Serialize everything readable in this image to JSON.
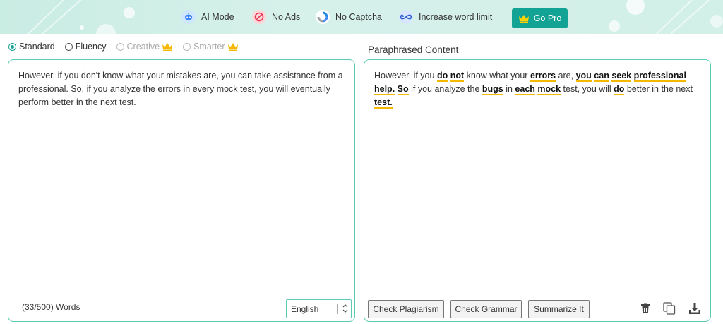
{
  "banner": {
    "features": [
      {
        "label": "AI Mode",
        "icon": "ai-mode-icon"
      },
      {
        "label": "No Ads",
        "icon": "no-ads-icon"
      },
      {
        "label": "No Captcha",
        "icon": "no-captcha-icon"
      },
      {
        "label": "Increase word limit",
        "icon": "infinity-icon"
      }
    ],
    "go_pro_label": "Go Pro"
  },
  "modes": [
    {
      "label": "Standard",
      "checked": true
    },
    {
      "label": "Fluency",
      "checked": false
    },
    {
      "label": "Creative",
      "checked": false,
      "premium": true
    },
    {
      "label": "Smarter",
      "checked": false,
      "premium": true
    }
  ],
  "input": {
    "text": "However, if you don't know what your mistakes are, you can take assistance from a professional. So, if you analyze the errors in every mock test, you will eventually perform better in the next test.",
    "word_count": "(33/500) Words",
    "language": "English"
  },
  "output": {
    "title": "Paraphrased Content",
    "segments": [
      {
        "t": "However, if you ",
        "c": false
      },
      {
        "t": "do",
        "c": true
      },
      {
        "t": " ",
        "c": false
      },
      {
        "t": "not",
        "c": true
      },
      {
        "t": " know what your ",
        "c": false
      },
      {
        "t": "errors",
        "c": true
      },
      {
        "t": " are, ",
        "c": false
      },
      {
        "t": "you",
        "c": true
      },
      {
        "t": " ",
        "c": false
      },
      {
        "t": "can",
        "c": true
      },
      {
        "t": " ",
        "c": false
      },
      {
        "t": "seek",
        "c": true
      },
      {
        "t": " ",
        "c": false
      },
      {
        "t": "professional",
        "c": true
      },
      {
        "t": " ",
        "c": false
      },
      {
        "t": "help.",
        "c": true
      },
      {
        "t": " ",
        "c": false
      },
      {
        "t": "So",
        "c": true
      },
      {
        "t": " if you analyze the ",
        "c": false
      },
      {
        "t": "bugs",
        "c": true
      },
      {
        "t": " in ",
        "c": false
      },
      {
        "t": "each",
        "c": true
      },
      {
        "t": " ",
        "c": false
      },
      {
        "t": "mock",
        "c": true
      },
      {
        "t": " test, you will ",
        "c": false
      },
      {
        "t": "do",
        "c": true
      },
      {
        "t": " better in the next ",
        "c": false
      },
      {
        "t": "test.",
        "c": true
      }
    ],
    "buttons": {
      "plagiarism": "Check Plagiarism",
      "grammar": "Check Grammar",
      "summarize": "Summarize It"
    },
    "icons": [
      "trash-icon",
      "copy-icon",
      "download-icon"
    ]
  },
  "colors": {
    "accent": "#13a394",
    "border": "#5cc9b4",
    "highlight": "#f5b800",
    "crown": "#f5b800"
  }
}
